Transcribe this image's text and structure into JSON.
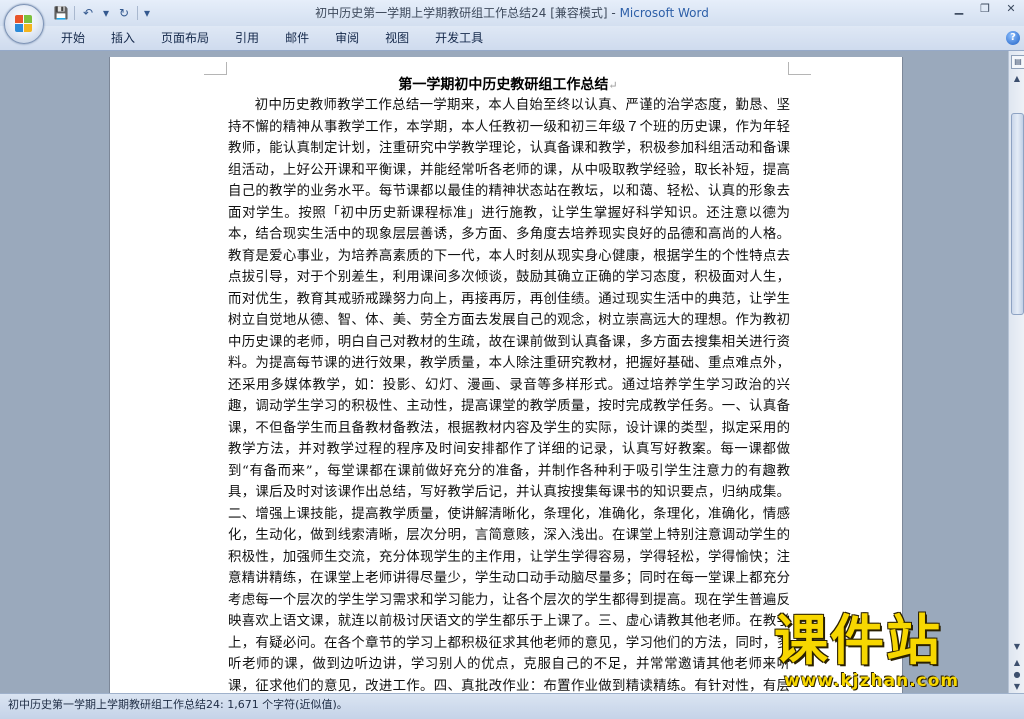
{
  "window": {
    "title": "初中历史第一学期上学期教研组工作总结24 [兼容模式] - ",
    "app_name": "Microsoft Word",
    "minimize": "▁",
    "restore": "❐",
    "close": "✕"
  },
  "quick_access": {
    "save": "💾",
    "undo": "↶",
    "undo_dropdown": "▾",
    "redo": "↻",
    "customize": "▾"
  },
  "ribbon": {
    "tabs": [
      {
        "label": "开始"
      },
      {
        "label": "插入"
      },
      {
        "label": "页面布局"
      },
      {
        "label": "引用"
      },
      {
        "label": "邮件"
      },
      {
        "label": "审阅"
      },
      {
        "label": "视图"
      },
      {
        "label": "开发工具"
      }
    ],
    "help": "?"
  },
  "document": {
    "title": "第一学期初中历史教研组工作总结",
    "paragraph_mark": "↵",
    "body": "初中历史教师教学工作总结一学期来，本人自始至终以认真、严谨的治学态度，勤恳、坚持不懈的精神从事教学工作，本学期，本人任教初一级和初三年级７个班的历史课，作为年轻教师，能认真制定计划，注重研究中学教学理论，认真备课和教学，积极参加科组活动和备课组活动，上好公开课和平衡课，并能经常听各老师的课，从中吸取教学经验，取长补短，提高自己的教学的业务水平。每节课都以最佳的精神状态站在教坛，以和蔼、轻松、认真的形象去面对学生。按照「初中历史新课程标准」进行施教，让学生掌握好科学知识。还注意以德为本，结合现实生活中的现象层层善诱，多方面、多角度去培养现实良好的品德和高尚的人格。教育是爱心事业，为培养高素质的下一代，本人时刻从现实身心健康，根据学生的个性特点去点拔引导，对于个别差生，利用课间多次倾谈，鼓励其确立正确的学习态度，积极面对人生，而对优生，教育其戒骄戒躁努力向上，再接再厉，再创佳绩。通过现实生活中的典范，让学生树立自觉地从德、智、体、美、劳全方面去发展自己的观念，树立崇高远大的理想。作为教初中历史课的老师，明白自己对教材的生疏，故在课前做到认真备课，多方面去搜集相关进行资料。为提高每节课的进行效果，教学质量，本人除注重研究教材，把握好基础、重点难点外，还采用多媒体教学，如：投影、幻灯、漫画、录音等多样形式。通过培养学生学习政治的兴趣，调动学生学习的积极性、主动性，提高课堂的教学质量，按时完成教学任务。一、认真备课，不但备学生而且备教材备教法，根据教材内容及学生的实际，设计课的类型，拟定采用的教学方法，并对教学过程的程序及时间安排都作了详细的记录，认真写好教案。每一课都做到“有备而来”，每堂课都在课前做好充分的准备，并制作各种利于吸引学生注意力的有趣教具，课后及时对该课作出总结，写好教学后记，并认真按搜集每课书的知识要点，归纳成集。二、增强上课技能，提高教学质量，使讲解清晰化，条理化，准确化，条理化，准确化，情感化，生动化，做到线索清晰，层次分明，言简意赅，深入浅出。在课堂上特别注意调动学生的积极性，加强师生交流，充分体现学生的主作用，让学生学得容易，学得轻松，学得愉快；注意精讲精练，在课堂上老师讲得尽量少，学生动口动手动脑尽量多；同时在每一堂课上都充分考虑每一个层次的学生学习需求和学习能力，让各个层次的学生都得到提高。现在学生普遍反映喜欢上语文课，就连以前极讨厌语文的学生都乐于上课了。三、虚心请教其他老师。在教学上，有疑必问。在各个章节的学习上都积极征求其他老师的意见，学习他们的方法，同时，多听老师的课，做到边听边讲，学习别人的优点，克服自己的不足，并常常邀请其他老师来听课，征求他们的意见，改进工作。四、真批改作业：布置作业做到精读精练。有针对性，有层次性。为了做到这点，我常常到各大书店去搜"
  },
  "statusbar": {
    "text": "初中历史第一学期上学期教研组工作总结24: 1,671 个字符(近似值)。"
  },
  "scrollbar": {
    "ruler_toggle": "▤",
    "up": "▲",
    "down": "▼",
    "prev_page": "▲",
    "select_browse": "●",
    "next_page": "▼"
  },
  "watermark": {
    "logo": "课件站",
    "url": "www.kjzhan.com"
  },
  "colors": {
    "titlebar": "#dfe8f5",
    "app_name": "#2d5fa8",
    "watermark": "#f7d700",
    "doc_background": "#9aa9bc"
  }
}
